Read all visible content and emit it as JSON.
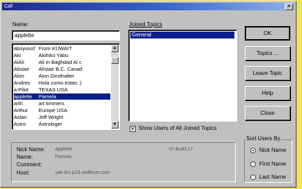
{
  "window": {
    "title": "Call",
    "close_glyph": "×"
  },
  "name_label": "Name:",
  "name_value": "applette",
  "users": [
    {
      "nick": "aboyusof",
      "real": "From KUWAIT"
    },
    {
      "nick": "Aki",
      "real": "Akihiko Yabu"
    },
    {
      "nick": "AlAli",
      "real": "Ali in Baghdad Al c"
    },
    {
      "nick": "Alistair",
      "real": "Alistair B.C. Canad"
    },
    {
      "nick": "Alon",
      "real": "Alon Gesthalter"
    },
    {
      "nick": "Andres",
      "real": "Hola como estas :)"
    },
    {
      "nick": "a-Pilot",
      "real": "TEXAS USA"
    },
    {
      "nick": "applette",
      "real": "Pamela",
      "selected": true
    },
    {
      "nick": "arth",
      "real": "art timmers"
    },
    {
      "nick": "Arthur",
      "real": "Europe USA"
    },
    {
      "nick": "Aslan",
      "real": "Jeff Wright"
    },
    {
      "nick": "Astro",
      "real": "Astrologer"
    }
  ],
  "joined_topics_label": "Joined Topics",
  "topics": [
    "General"
  ],
  "buttons": {
    "ok": "OK",
    "topics": "Topics ...",
    "leave_topic": "Leave Topic",
    "help": "Help",
    "close": "Close"
  },
  "show_all_checkbox": {
    "label": "Show Users of All Joined Topics",
    "checked": true,
    "mark": "✕"
  },
  "info": {
    "nick_label": "Nick Name:",
    "nick_value": "applette",
    "name_label": "Name:",
    "name_value": "Pamela",
    "comment_label": "Comment:",
    "comment_value": "",
    "host_label": "Host:",
    "host_value": "yak-ts1-p15.wolfenet.com",
    "build": "®¹ Build:17"
  },
  "sort": {
    "label": "Sort Users By",
    "options": [
      {
        "label": "Nick Name",
        "selected": true
      },
      {
        "label": "First Name",
        "selected": false
      },
      {
        "label": "Last Name",
        "selected": false
      }
    ]
  },
  "colors": {
    "selection": "#0a1f8a",
    "titlebar": "#1c2a8c",
    "background": "#f2e44a"
  }
}
